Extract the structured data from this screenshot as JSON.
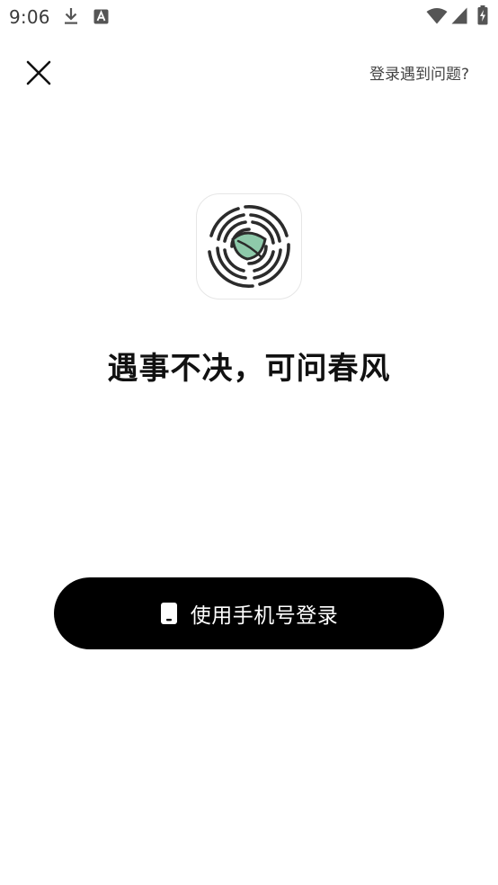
{
  "status_bar": {
    "time": "9:06",
    "icons": [
      "download-icon",
      "font-app-icon",
      "wifi-icon",
      "signal-icon",
      "battery-charging-icon"
    ]
  },
  "header": {
    "close_icon": "close-icon",
    "help_link": "登录遇到问题?"
  },
  "logo": {
    "icon": "leaf-rings-logo",
    "leaf_color": "#8ec9aa",
    "ring_color": "#2b2b2b"
  },
  "slogan": "遇事不决，可问春风",
  "login": {
    "label": "使用手机号登录",
    "icon": "phone-icon",
    "bg_color": "#000000",
    "text_color": "#ffffff"
  }
}
